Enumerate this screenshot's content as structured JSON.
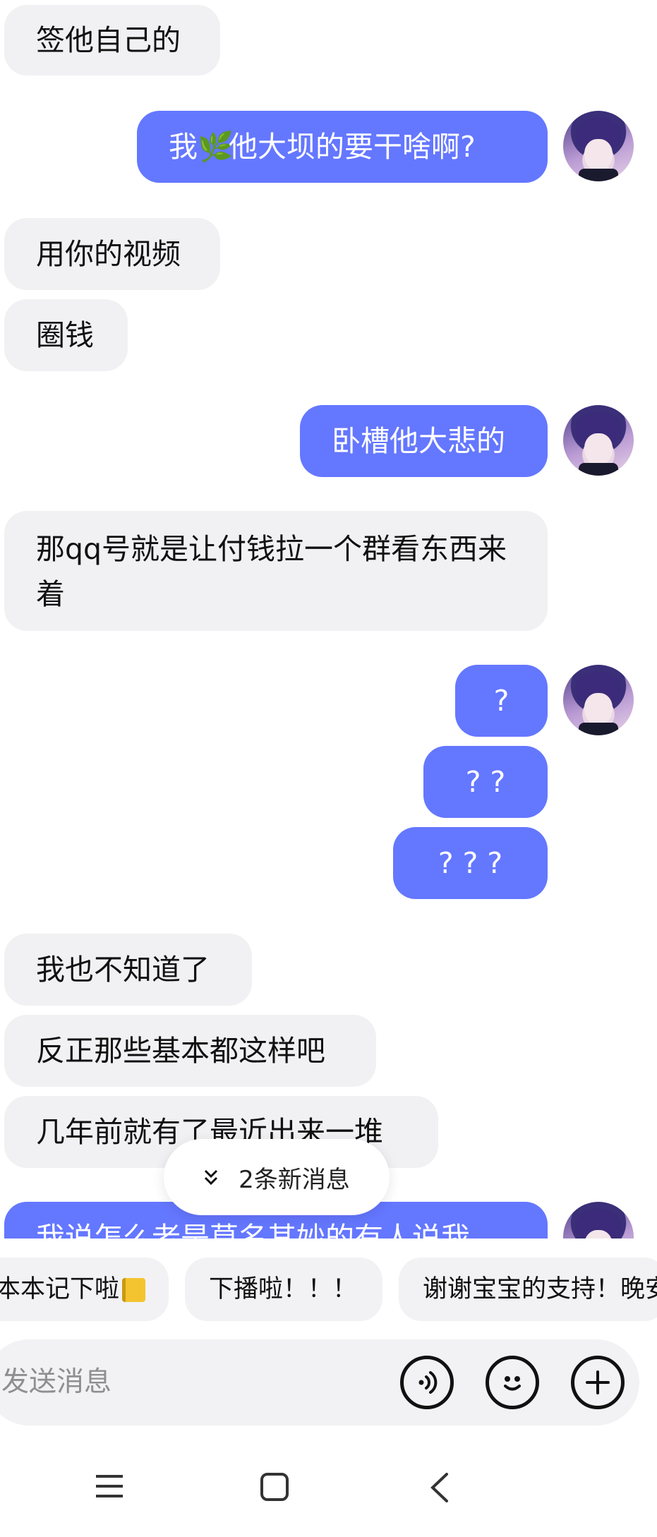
{
  "messages": [
    {
      "side": "in",
      "text": "签他自己的"
    },
    {
      "side": "out",
      "text_before": "我",
      "emoji": "🌿",
      "text_after": "他大坝的要干啥啊?"
    },
    {
      "side": "in",
      "text": "用你的视频"
    },
    {
      "side": "in",
      "text": "圈钱"
    },
    {
      "side": "out",
      "text": "卧槽他大悲的"
    },
    {
      "side": "in",
      "text": "那qq号就是让付钱拉一个群看东西来着"
    },
    {
      "side": "out",
      "text": "?"
    },
    {
      "side": "out",
      "text": "? ?"
    },
    {
      "side": "out",
      "text": "? ? ?"
    },
    {
      "side": "in",
      "text": "我也不知道了"
    },
    {
      "side": "in",
      "text": "反正那些基本都这样吧"
    },
    {
      "side": "in",
      "text": "几年前就有了最近出来一堆"
    },
    {
      "side": "out",
      "text": "我说怎么老是莫名其妙的有人说我"
    }
  ],
  "new_messages": {
    "icon": "double-chevron-down-icon",
    "label": "2条新消息"
  },
  "quick_replies": [
    "本本记下啦",
    "下播啦！！！",
    "谢谢宝宝的支持！晚安"
  ],
  "input": {
    "placeholder": "发送消息"
  },
  "buttons": {
    "voice_icon": "voice-icon",
    "emoji_icon": "emoji-smile-icon",
    "plus_icon": "plus-icon"
  },
  "nav": {
    "menu_icon": "menu-icon",
    "home_icon": "home-square-icon",
    "back_icon": "back-chevron-icon"
  },
  "colors": {
    "outgoing": "#6477ff",
    "incoming": "#f1f1f3",
    "background": "#ffffff"
  }
}
